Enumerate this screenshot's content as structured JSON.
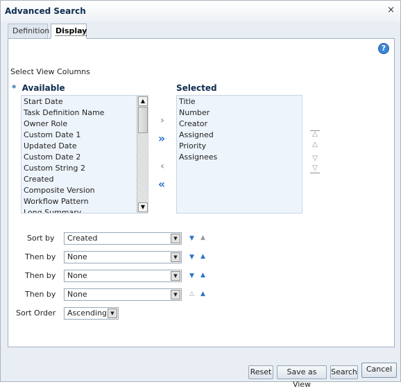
{
  "dialog": {
    "title": "Advanced Search",
    "close_glyph": "×"
  },
  "tabs": [
    {
      "label": "Definition",
      "selected": false
    },
    {
      "label": "Display",
      "selected": true
    }
  ],
  "help_glyph": "?",
  "view_columns": {
    "section_label": "Select View Columns",
    "required_mark": "*",
    "available_header": "Available",
    "selected_header": "Selected",
    "available_items": [
      "Start Date",
      "Task Definition Name",
      "Owner Role",
      "Custom Date 1",
      "Updated Date",
      "Custom Date 2",
      "Custom String 2",
      "Created",
      "Composite Version",
      "Workflow Pattern",
      "Long Summary"
    ],
    "selected_items": [
      "Title",
      "Number",
      "Creator",
      "Assigned",
      "Priority",
      "Assignees"
    ]
  },
  "sort": {
    "rows": [
      {
        "label": "Sort by",
        "value": "Created"
      },
      {
        "label": "Then by",
        "value": "None"
      },
      {
        "label": "Then by",
        "value": "None"
      },
      {
        "label": "Then by",
        "value": "None"
      }
    ],
    "order_label": "Sort Order",
    "order_value": "Ascending"
  },
  "buttons": {
    "reset": "Reset",
    "save_as_view": "Save as View",
    "search": "Search",
    "cancel": "Cancel"
  },
  "icons": {
    "move_right": "chevron-right-icon",
    "move_all_right": "double-chevron-right-icon",
    "move_left": "chevron-left-icon",
    "move_all_left": "double-chevron-left-icon",
    "move_top": "move-top-icon",
    "move_up": "move-up-icon",
    "move_down": "move-down-icon",
    "move_bottom": "move-bottom-icon"
  },
  "colors": {
    "accent": "#2b73c9",
    "header": "#0e2c4f",
    "list_bg": "#eef4fb"
  }
}
